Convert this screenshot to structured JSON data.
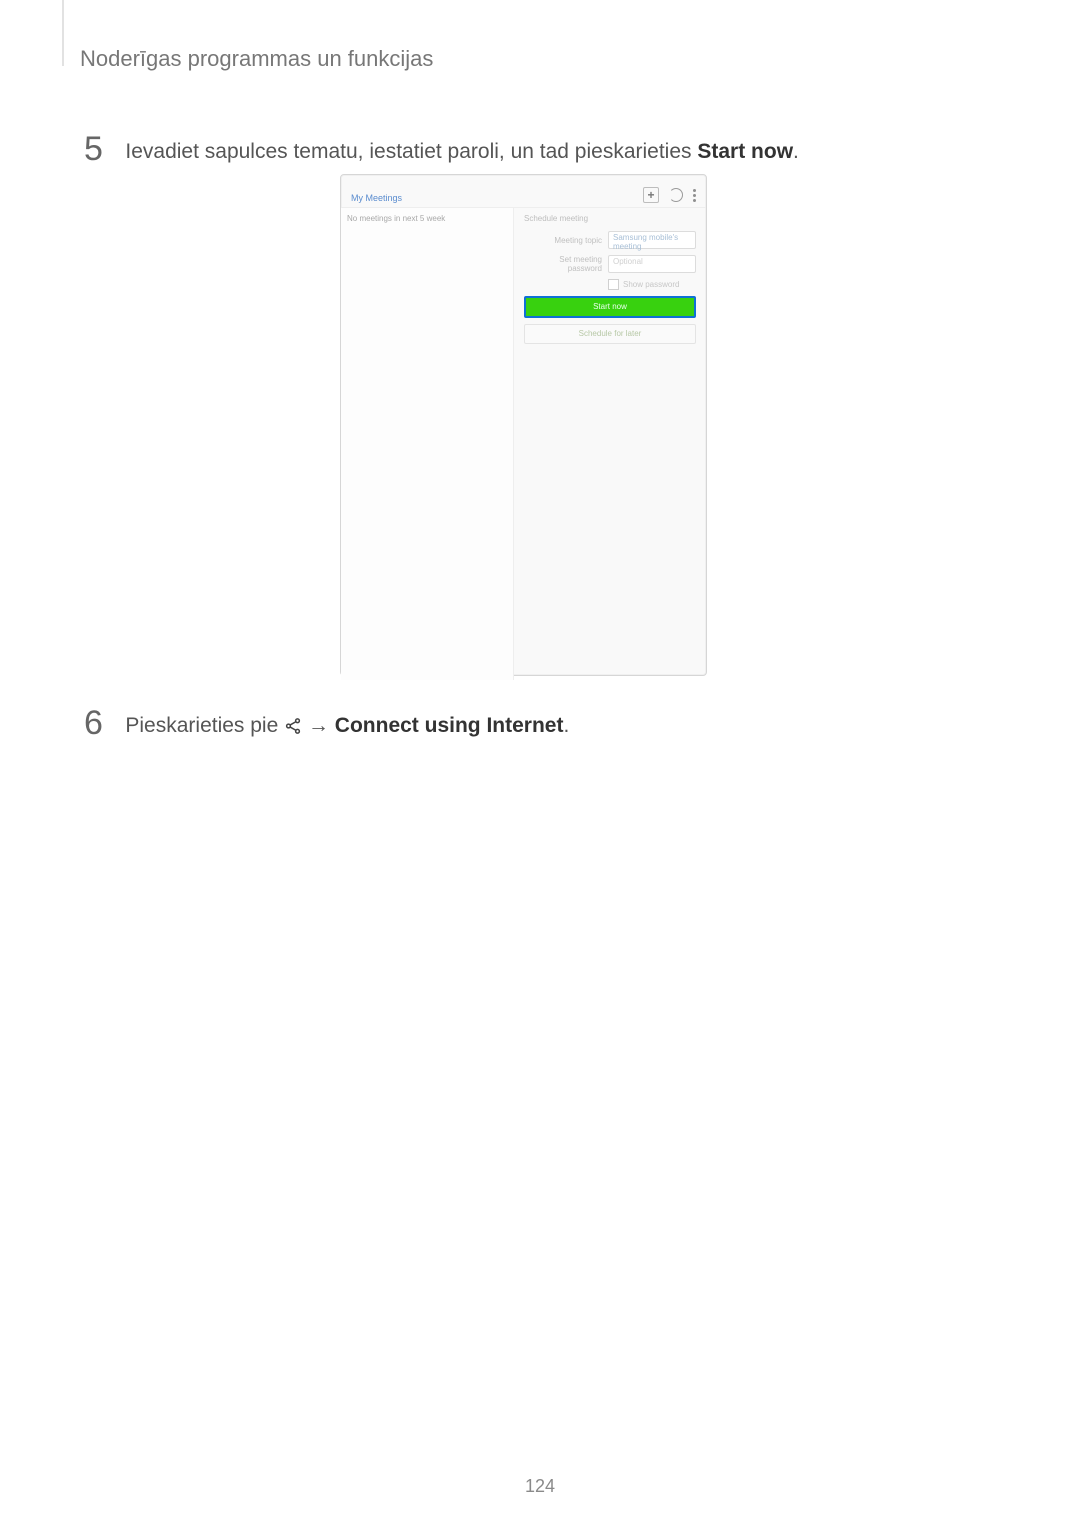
{
  "section_title": "Noderīgas programmas un funkcijas",
  "step5": {
    "num": "5",
    "pre": "Ievadiet sapulces tematu, iestatiet paroli, un tad pieskarieties ",
    "bold": "Start now",
    "post": "."
  },
  "device": {
    "title": "My Meetings",
    "side_text": "No meetings in next 5 week",
    "pane_title": "Schedule meeting",
    "topic_label": "Meeting topic",
    "topic_value": "Samsung mobile's meeting",
    "pwd_label": "Set meeting password",
    "pwd_placeholder": "Optional",
    "show_pwd": "Show password",
    "start_now": "Start now",
    "schedule_later": "Schedule for later"
  },
  "step6": {
    "num": "6",
    "pre": "Pieskarieties pie ",
    "arrow": " → ",
    "bold": "Connect using Internet",
    "post": "."
  },
  "page_number": "124"
}
